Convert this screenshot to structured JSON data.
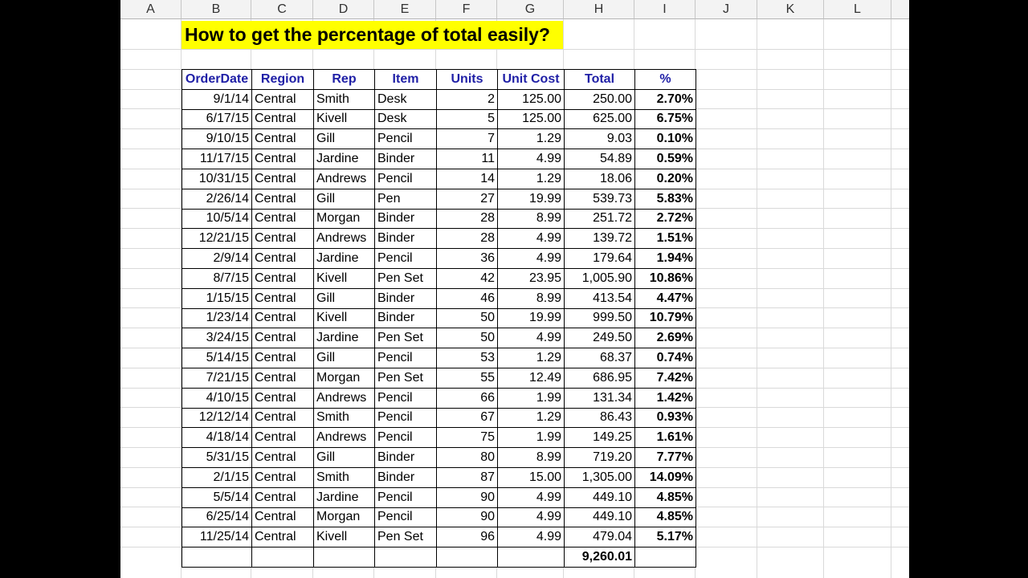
{
  "columns": [
    "A",
    "B",
    "C",
    "D",
    "E",
    "F",
    "G",
    "H",
    "I",
    "J",
    "K",
    "L"
  ],
  "title": "How to get the percentage of total easily?",
  "headers": [
    "OrderDate",
    "Region",
    "Rep",
    "Item",
    "Units",
    "Unit Cost",
    "Total",
    "%"
  ],
  "rows": [
    [
      "9/1/14",
      "Central",
      "Smith",
      "Desk",
      "2",
      "125.00",
      "250.00",
      "2.70%"
    ],
    [
      "6/17/15",
      "Central",
      "Kivell",
      "Desk",
      "5",
      "125.00",
      "625.00",
      "6.75%"
    ],
    [
      "9/10/15",
      "Central",
      "Gill",
      "Pencil",
      "7",
      "1.29",
      "9.03",
      "0.10%"
    ],
    [
      "11/17/15",
      "Central",
      "Jardine",
      "Binder",
      "11",
      "4.99",
      "54.89",
      "0.59%"
    ],
    [
      "10/31/15",
      "Central",
      "Andrews",
      "Pencil",
      "14",
      "1.29",
      "18.06",
      "0.20%"
    ],
    [
      "2/26/14",
      "Central",
      "Gill",
      "Pen",
      "27",
      "19.99",
      "539.73",
      "5.83%"
    ],
    [
      "10/5/14",
      "Central",
      "Morgan",
      "Binder",
      "28",
      "8.99",
      "251.72",
      "2.72%"
    ],
    [
      "12/21/15",
      "Central",
      "Andrews",
      "Binder",
      "28",
      "4.99",
      "139.72",
      "1.51%"
    ],
    [
      "2/9/14",
      "Central",
      "Jardine",
      "Pencil",
      "36",
      "4.99",
      "179.64",
      "1.94%"
    ],
    [
      "8/7/15",
      "Central",
      "Kivell",
      "Pen Set",
      "42",
      "23.95",
      "1,005.90",
      "10.86%"
    ],
    [
      "1/15/15",
      "Central",
      "Gill",
      "Binder",
      "46",
      "8.99",
      "413.54",
      "4.47%"
    ],
    [
      "1/23/14",
      "Central",
      "Kivell",
      "Binder",
      "50",
      "19.99",
      "999.50",
      "10.79%"
    ],
    [
      "3/24/15",
      "Central",
      "Jardine",
      "Pen Set",
      "50",
      "4.99",
      "249.50",
      "2.69%"
    ],
    [
      "5/14/15",
      "Central",
      "Gill",
      "Pencil",
      "53",
      "1.29",
      "68.37",
      "0.74%"
    ],
    [
      "7/21/15",
      "Central",
      "Morgan",
      "Pen Set",
      "55",
      "12.49",
      "686.95",
      "7.42%"
    ],
    [
      "4/10/15",
      "Central",
      "Andrews",
      "Pencil",
      "66",
      "1.99",
      "131.34",
      "1.42%"
    ],
    [
      "12/12/14",
      "Central",
      "Smith",
      "Pencil",
      "67",
      "1.29",
      "86.43",
      "0.93%"
    ],
    [
      "4/18/14",
      "Central",
      "Andrews",
      "Pencil",
      "75",
      "1.99",
      "149.25",
      "1.61%"
    ],
    [
      "5/31/15",
      "Central",
      "Gill",
      "Binder",
      "80",
      "8.99",
      "719.20",
      "7.77%"
    ],
    [
      "2/1/15",
      "Central",
      "Smith",
      "Binder",
      "87",
      "15.00",
      "1,305.00",
      "14.09%"
    ],
    [
      "5/5/14",
      "Central",
      "Jardine",
      "Pencil",
      "90",
      "4.99",
      "449.10",
      "4.85%"
    ],
    [
      "6/25/14",
      "Central",
      "Morgan",
      "Pencil",
      "90",
      "4.99",
      "449.10",
      "4.85%"
    ],
    [
      "11/25/14",
      "Central",
      "Kivell",
      "Pen Set",
      "96",
      "4.99",
      "479.04",
      "5.17%"
    ]
  ],
  "grand_total": "9,260.01",
  "colors": {
    "title_bg": "#ffff00",
    "header_text": "#1f1fa6",
    "gridline": "#d9d9d9"
  }
}
